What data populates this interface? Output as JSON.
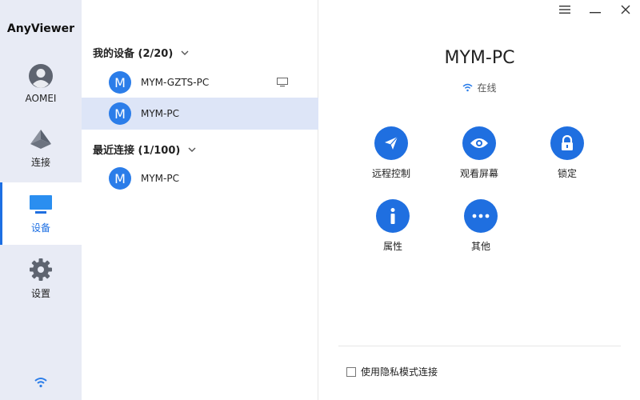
{
  "app": {
    "title": "AnyViewer"
  },
  "nav": {
    "items": [
      {
        "label": "AOMEI",
        "icon": "avatar-icon"
      },
      {
        "label": "连接",
        "icon": "connect-icon"
      },
      {
        "label": "设备",
        "icon": "monitor-icon"
      },
      {
        "label": "设置",
        "icon": "gear-icon"
      }
    ],
    "active": "设备"
  },
  "devices": {
    "my_devices_title": "我的设备 (2/20)",
    "my_devices": [
      {
        "avatar": "M",
        "name": "MYM-GZTS-PC"
      },
      {
        "avatar": "M",
        "name": "MYM-PC"
      }
    ],
    "recent_title": "最近连接 (1/100)",
    "recent": [
      {
        "avatar": "M",
        "name": "MYM-PC"
      }
    ]
  },
  "detail": {
    "device_name": "MYM-PC",
    "status": "在线",
    "actions": [
      {
        "label": "远程控制",
        "icon": "send-icon"
      },
      {
        "label": "观看屏幕",
        "icon": "eye-icon"
      },
      {
        "label": "锁定",
        "icon": "lock-icon"
      },
      {
        "label": "属性",
        "icon": "info-icon"
      },
      {
        "label": "其他",
        "icon": "more-icon"
      }
    ],
    "privacy_label": "使用隐私模式连接"
  },
  "colors": {
    "accent": "#1f6fe0",
    "nav_bg": "#e8ebf5",
    "selected_row": "#dde5f7",
    "avatar": "#2b7de9"
  }
}
